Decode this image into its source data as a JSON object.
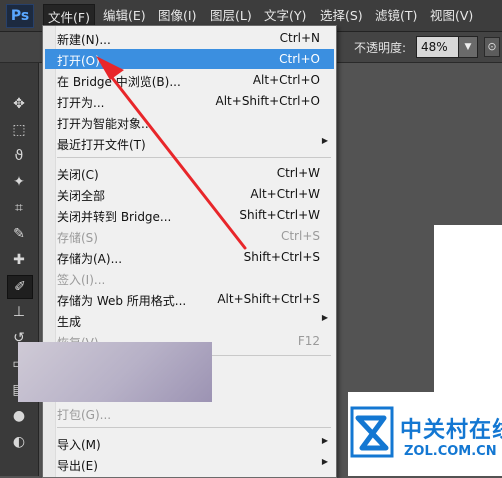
{
  "app": {
    "logo": "Ps"
  },
  "menubar": {
    "items": [
      {
        "label": "文件(F)"
      },
      {
        "label": "编辑(E)"
      },
      {
        "label": "图像(I)"
      },
      {
        "label": "图层(L)"
      },
      {
        "label": "文字(Y)"
      },
      {
        "label": "选择(S)"
      },
      {
        "label": "滤镜(T)"
      },
      {
        "label": "视图(V)"
      }
    ]
  },
  "options": {
    "opacity_label": "不透明度:",
    "opacity_value": "48%"
  },
  "file_menu": {
    "items": [
      {
        "label": "新建(N)...",
        "shortcut": "Ctrl+N"
      },
      {
        "label": "打开(O)...",
        "shortcut": "Ctrl+O"
      },
      {
        "label": "在 Bridge 中浏览(B)...",
        "shortcut": "Alt+Ctrl+O"
      },
      {
        "label": "打开为...",
        "shortcut": "Alt+Shift+Ctrl+O"
      },
      {
        "label": "打开为智能对象...",
        "shortcut": ""
      },
      {
        "label": "最近打开文件(T)",
        "shortcut": ""
      },
      {
        "label": "关闭(C)",
        "shortcut": "Ctrl+W"
      },
      {
        "label": "关闭全部",
        "shortcut": "Alt+Ctrl+W"
      },
      {
        "label": "关闭并转到 Bridge...",
        "shortcut": "Shift+Ctrl+W"
      },
      {
        "label": "存储(S)",
        "shortcut": "Ctrl+S"
      },
      {
        "label": "存储为(A)...",
        "shortcut": "Shift+Ctrl+S"
      },
      {
        "label": "签入(I)...",
        "shortcut": ""
      },
      {
        "label": "存储为 Web 所用格式...",
        "shortcut": "Alt+Shift+Ctrl+S"
      },
      {
        "label": "生成",
        "shortcut": ""
      },
      {
        "label": "恢复(V)",
        "shortcut": "F12"
      },
      {
        "label": "打包(G)...",
        "shortcut": ""
      },
      {
        "label": "导入(M)",
        "shortcut": ""
      },
      {
        "label": "导出(E)",
        "shortcut": ""
      }
    ]
  },
  "watermark": {
    "title": "中关村在线",
    "subtitle": "ZOL.COM.CN"
  },
  "colors": {
    "highlight": "#3b8fe0",
    "annotation_arrow": "#e8262a",
    "brand": "#1377d2"
  }
}
